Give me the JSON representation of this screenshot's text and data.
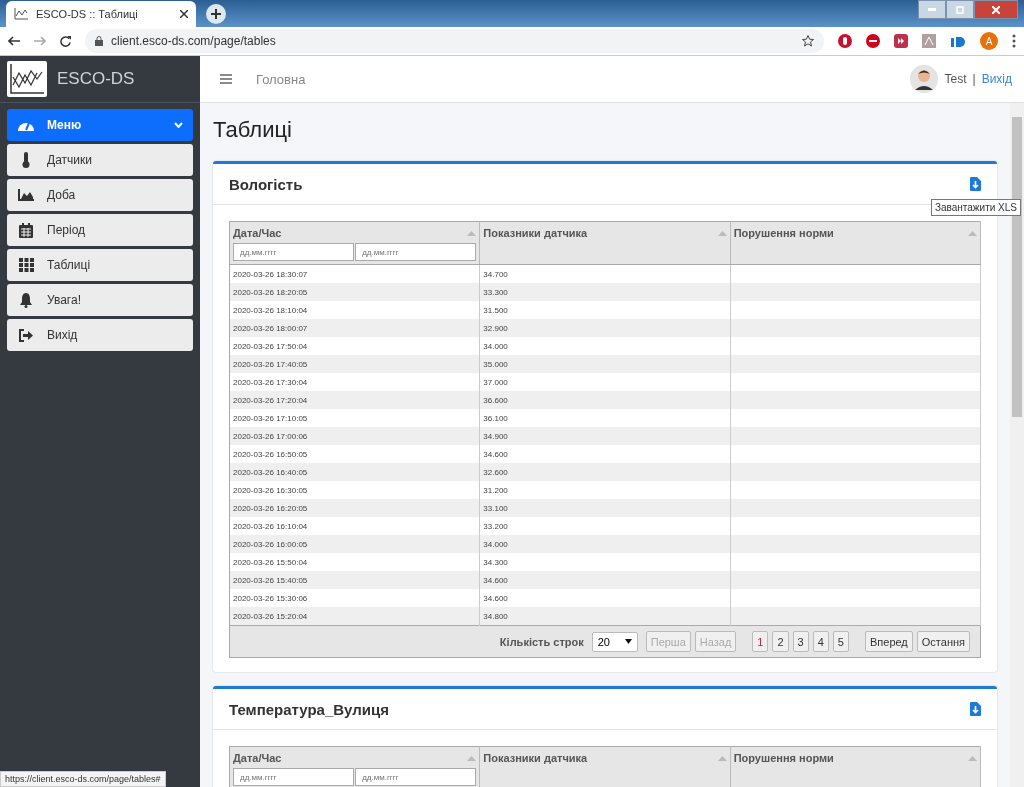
{
  "browser": {
    "tab_title": "ESCO-DS :: Таблиці",
    "url": "client.esco-ds.com/page/tables",
    "profile_initial": "A",
    "status_url": "https://client.esco-ds.com/page/tables#"
  },
  "sidebar": {
    "brand": "ESCO-DS",
    "menu": {
      "label": "Меню",
      "expanded": true
    },
    "items": [
      {
        "label": "Датчики"
      },
      {
        "label": "Доба"
      },
      {
        "label": "Період"
      },
      {
        "label": "Таблиці"
      },
      {
        "label": "Увага!"
      },
      {
        "label": "Вихід"
      }
    ]
  },
  "topbar": {
    "breadcrumb": "Головна",
    "user": "Test",
    "separator": "|",
    "logout": "Вихід"
  },
  "page_title": "Таблиці",
  "tooltip": "Завантажити XLS",
  "tables": [
    {
      "title": "Вологість",
      "columns": [
        "Дата/Час",
        "Показники датчика",
        "Порушення норми"
      ],
      "date_from_placeholder": "дд.мм.гггг",
      "date_to_placeholder": "дд.мм.гггг",
      "rows": [
        {
          "time": "2020-03-26 18:30:07",
          "reading": "34.700"
        },
        {
          "time": "2020-03-26 18:20:05",
          "reading": "33.300"
        },
        {
          "time": "2020-03-26 18:10:04",
          "reading": "31.500"
        },
        {
          "time": "2020-03-26 18:00:07",
          "reading": "32.900"
        },
        {
          "time": "2020-03-26 17:50:04",
          "reading": "34.000"
        },
        {
          "time": "2020-03-26 17:40:05",
          "reading": "35.000"
        },
        {
          "time": "2020-03-26 17:30:04",
          "reading": "37.000"
        },
        {
          "time": "2020-03-26 17:20:04",
          "reading": "36.600"
        },
        {
          "time": "2020-03-26 17:10:05",
          "reading": "36.100"
        },
        {
          "time": "2020-03-26 17:00:06",
          "reading": "34.900"
        },
        {
          "time": "2020-03-26 16:50:05",
          "reading": "34.600"
        },
        {
          "time": "2020-03-26 16:40:05",
          "reading": "32.600"
        },
        {
          "time": "2020-03-26 16:30:05",
          "reading": "31.200"
        },
        {
          "time": "2020-03-26 16:20:05",
          "reading": "33.100"
        },
        {
          "time": "2020-03-26 16:10:04",
          "reading": "33.200"
        },
        {
          "time": "2020-03-26 16:00:05",
          "reading": "34.000"
        },
        {
          "time": "2020-03-26 15:50:04",
          "reading": "34.300"
        },
        {
          "time": "2020-03-26 15:40:05",
          "reading": "34.600"
        },
        {
          "time": "2020-03-26 15:30:06",
          "reading": "34.600"
        },
        {
          "time": "2020-03-26 15:20:04",
          "reading": "34.800"
        }
      ],
      "pagination": {
        "rows_label": "Кількість строк",
        "page_size": "20",
        "first": {
          "label": "Перша",
          "disabled": true
        },
        "prev": {
          "label": "Назад",
          "disabled": true
        },
        "pages": [
          {
            "label": "1",
            "selected": true
          },
          {
            "label": "2",
            "selected": false
          },
          {
            "label": "3",
            "selected": false
          },
          {
            "label": "4",
            "selected": false
          },
          {
            "label": "5",
            "selected": false
          }
        ],
        "next": {
          "label": "Вперед",
          "disabled": false
        },
        "last": {
          "label": "Остання",
          "disabled": false
        }
      }
    },
    {
      "title": "Температура_Вулиця",
      "columns": [
        "Дата/Час",
        "Показники датчика",
        "Порушення норми"
      ],
      "date_from_placeholder": "дд.мм.гггг",
      "date_to_placeholder": "дд.мм.гггг"
    }
  ]
}
